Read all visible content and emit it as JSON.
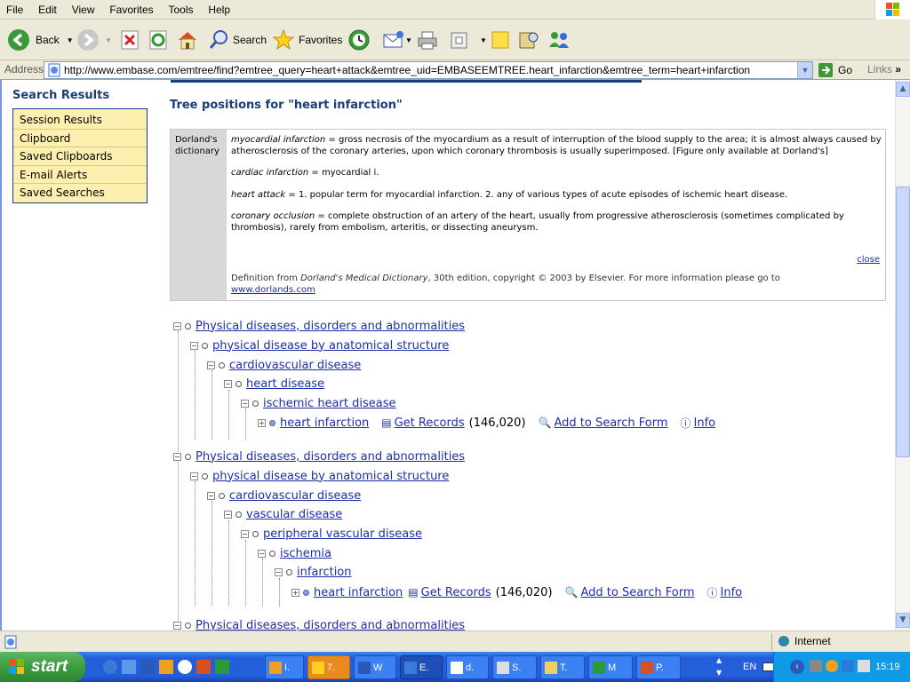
{
  "browser": {
    "menu": [
      "File",
      "Edit",
      "View",
      "Favorites",
      "Tools",
      "Help"
    ],
    "toolbar": {
      "back": "Back",
      "search": "Search",
      "favorites": "Favorites"
    },
    "address_label": "Address",
    "url": "http://www.embase.com/emtree/find?emtree_query=heart+attack&emtree_uid=EMBASEEMTREE.heart_infarction&emtree_term=heart+infarction",
    "go": "Go",
    "links": "Links",
    "status_zone": "Internet"
  },
  "sidebar": {
    "title": "Search Results",
    "items": [
      "Session Results",
      "Clipboard",
      "Saved Clipboards",
      "E-mail Alerts",
      "Saved Searches"
    ]
  },
  "main": {
    "title": "Tree positions for \"heart infarction\"",
    "dictionary": {
      "label_line1": "Dorland's",
      "label_line2": "dictionary",
      "entries": [
        {
          "term": "myocardial infarction",
          "def": " = gross necrosis of the myocardium as a result of interruption of the blood supply to the area; it is almost always caused by atherosclerosis of the coronary arteries, upon which coronary thrombosis is usually superimposed. [Figure only available at Dorland's]"
        },
        {
          "term": "cardiac infarction",
          "def": " = myocardial i."
        },
        {
          "term": "heart attack",
          "def": " = 1. popular term for myocardial infarction. 2. any of various types of acute episodes of ischemic heart disease."
        },
        {
          "term": "coronary occlusion",
          "def": " = complete obstruction of an artery of the heart, usually from progressive atherosclerosis (sometimes complicated by thrombosis), rarely from embolism, arteritis, or dissecting aneurysm."
        }
      ],
      "close": "close",
      "footer_pre": "Definition from ",
      "footer_book": "Dorland's Medical Dictionary",
      "footer_post": ", 30th edition, copyright © 2003 by Elsevier. For more information please go to",
      "footer_link": "www.dorlands.com"
    },
    "tree1": [
      "Physical diseases, disorders and abnormalities",
      "physical disease by anatomical structure",
      "cardiovascular disease",
      "heart disease",
      "ischemic heart disease"
    ],
    "tree2": [
      "Physical diseases, disorders and abnormalities",
      "physical disease by anatomical structure",
      "cardiovascular disease",
      "vascular disease",
      "peripheral vascular disease",
      "ischemia",
      "infarction"
    ],
    "tree3_first": "Physical diseases, disorders and abnormalities",
    "leaf": {
      "term": "heart infarction",
      "get_records": "Get Records",
      "count": "(146,020)",
      "add": "Add to Search Form",
      "info": "Info"
    }
  },
  "taskbar": {
    "start": "start",
    "items": [
      "I.",
      "7.",
      "W",
      "E.",
      "d.",
      "S.",
      "T.",
      "M",
      "P."
    ],
    "lang": "EN",
    "clock": "15:19"
  }
}
